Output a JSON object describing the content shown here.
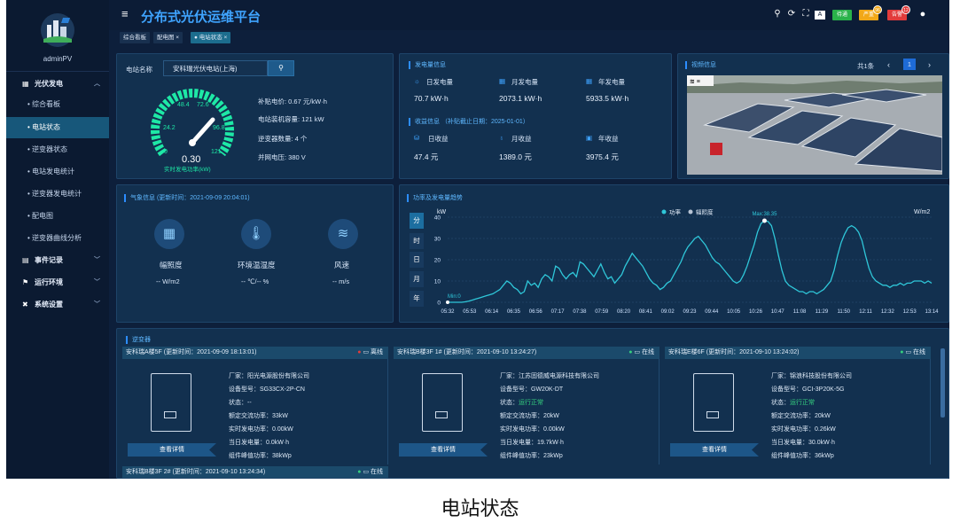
{
  "app": {
    "title": "分布式光伏运维平台",
    "user": "adminPV"
  },
  "caption": "电站状态",
  "colors": {
    "accent": "#2c8dff",
    "online": "#35d07f",
    "offline": "#e23b3b",
    "gauge": "#1ee8a6"
  },
  "header": {
    "icons": [
      "search-icon",
      "refresh-icon",
      "fullscreen-icon",
      "font-size-icon",
      "user-icon"
    ],
    "badges": [
      {
        "label": "待通",
        "color": "#2ab24a",
        "count": ""
      },
      {
        "label": "严重",
        "color": "#f2a818",
        "count": "96"
      },
      {
        "label": "告警",
        "color": "#e23b3b",
        "count": "12"
      }
    ]
  },
  "tabs": [
    {
      "label": "综合看板"
    },
    {
      "label": "配电图 ×"
    },
    {
      "label": "● 电站状态 ×"
    }
  ],
  "sidebar": {
    "groups": [
      {
        "label": "光伏发电",
        "icon": "grid-icon",
        "expanded": true
      },
      {
        "label": "事件记录",
        "icon": "calendar-icon"
      },
      {
        "label": "运行环境",
        "icon": "flag-icon"
      },
      {
        "label": "系统设置",
        "icon": "tools-icon"
      }
    ],
    "items": [
      {
        "label": "• 综合看板"
      },
      {
        "label": "• 电站状态",
        "active": true
      },
      {
        "label": "• 逆变器状态"
      },
      {
        "label": "• 电站发电统计"
      },
      {
        "label": "• 逆变器发电统计"
      },
      {
        "label": "• 配电图"
      },
      {
        "label": "• 逆变器曲线分析"
      }
    ]
  },
  "station": {
    "name_label": "电站名称",
    "name_value": "安科瑞光伏电站(上海)",
    "search_icon": "search-icon",
    "gauge": {
      "value": "0.30",
      "max": 121,
      "ticks": [
        "24.2",
        "48.4",
        "72.6",
        "96.8",
        "121"
      ],
      "zero": "0",
      "label": "实时发电功率(kW)"
    },
    "info": [
      {
        "label": "补贴电价: 0.67 元/kW·h"
      },
      {
        "label": "电站装机容量: 121 kW"
      },
      {
        "label": "逆变器数量: 4 个"
      },
      {
        "label": "并网电压: 380 V"
      }
    ]
  },
  "generation": {
    "title": "发电量信息",
    "items": [
      {
        "icon": "sun-icon",
        "label": "日发电量",
        "value": "70.7 kW·h"
      },
      {
        "icon": "calendar-icon",
        "label": "月发电量",
        "value": "2073.1 kW·h"
      },
      {
        "icon": "calendar-icon",
        "label": "年发电量",
        "value": "5933.5 kW·h"
      }
    ]
  },
  "income": {
    "title": "收益信息 （补贴截止日期：2025-01-01）",
    "items": [
      {
        "icon": "coins-icon",
        "label": "日收益",
        "value": "47.4 元"
      },
      {
        "icon": "money-bag-icon",
        "label": "月收益",
        "value": "1389.0 元"
      },
      {
        "icon": "wallet-icon",
        "label": "年收益",
        "value": "3975.4 元"
      }
    ]
  },
  "video": {
    "title": "视频信息",
    "total": "共1条",
    "page": "1",
    "prev": "‹",
    "next": "›"
  },
  "weather": {
    "title": "气象信息 (更新时间：2021-09-09 20:04:01)",
    "items": [
      {
        "icon": "solar-panel-icon",
        "label": "幅照度",
        "value": "-- W/m2"
      },
      {
        "icon": "thermometer-icon",
        "label": "环境温湿度",
        "value": "-- ℃/-- %"
      },
      {
        "icon": "wind-icon",
        "label": "风速",
        "value": "-- m/s"
      }
    ]
  },
  "chart_data": {
    "type": "line",
    "title": "功率及发电量趋势",
    "ylabel": "kW",
    "ylabel_right": "W/m2",
    "legend": [
      "功率",
      "辐照度"
    ],
    "legend_position": "top-right",
    "period_buttons": [
      "分",
      "时",
      "日",
      "月",
      "年"
    ],
    "period_active": "分",
    "ylim": [
      0,
      40
    ],
    "yticks": [
      "0",
      "10",
      "20",
      "30",
      "40"
    ],
    "xticks": [
      "05:32",
      "05:53",
      "06:14",
      "06:35",
      "06:56",
      "07:17",
      "07:38",
      "07:59",
      "08:20",
      "08:41",
      "09:02",
      "09:23",
      "09:44",
      "10:05",
      "10:26",
      "10:47",
      "11:08",
      "11:29",
      "11:50",
      "12:11",
      "12:32",
      "12:53",
      "13:14"
    ],
    "max_label": "Max:38.35",
    "min_label": "Min:0",
    "series": [
      {
        "name": "功率",
        "values": [
          0,
          0,
          0,
          0,
          0,
          0.2,
          0.5,
          1,
          1.5,
          2,
          2.5,
          3,
          3.5,
          4,
          5,
          6,
          8,
          10,
          9,
          7,
          6,
          4,
          5,
          10,
          8,
          9,
          7,
          11,
          13,
          12,
          10,
          17,
          16,
          13,
          11,
          13,
          14,
          12,
          19,
          18,
          16,
          14,
          12,
          15,
          18,
          14,
          11,
          12,
          9,
          11,
          13,
          17,
          20,
          23,
          21,
          19,
          17,
          14,
          11,
          9,
          8,
          6,
          7,
          9,
          10,
          13,
          16,
          19,
          23,
          26,
          28,
          30,
          31,
          29,
          27,
          24,
          21,
          19,
          18,
          16,
          14,
          12,
          10,
          9,
          10,
          13,
          17,
          22,
          27,
          33,
          37,
          38.35,
          38,
          36,
          30,
          22,
          15,
          10,
          8,
          7,
          6,
          5,
          5,
          4,
          5,
          5,
          4,
          5,
          6,
          8,
          10,
          15,
          22,
          28,
          32,
          35,
          36,
          35,
          33,
          29,
          22,
          16,
          12,
          10,
          9,
          8,
          8,
          7,
          8,
          8,
          9,
          8,
          9,
          9,
          10,
          10,
          10,
          9,
          10,
          9
        ]
      }
    ]
  },
  "inverters": {
    "title": "逆变器",
    "detail_label": "查看详情",
    "devices": [
      {
        "header": "安科瑞A楼5F (更新时间：2021-09-09 18:13:01)",
        "status": "离线",
        "online": false,
        "factory": "厂家：阳光电源股份有限公司",
        "model": "设备型号：SG33CX-2P-CN",
        "state_label": "状态：",
        "state_value": "--",
        "rated": "额定交流功率：33kW",
        "realtime": "实时发电功率：0.00kW",
        "daily": "当日发电量：0.0kW·h",
        "component": "组件峰值功率：38kWp"
      },
      {
        "header": "安科瑞B楼3F 1# (更新时间：2021-09-10 13:24:27)",
        "status": "在线",
        "online": true,
        "factory": "厂家：江苏固德威电源科技有限公司",
        "model": "设备型号：GW20K-DT",
        "state_label": "状态：",
        "state_value": "运行正常",
        "rated": "额定交流功率：20kW",
        "realtime": "实时发电功率：0.00kW",
        "daily": "当日发电量：19.7kW·h",
        "component": "组件峰值功率：23kWp"
      },
      {
        "header": "安科瑞E楼6F (更新时间：2021-09-10 13:24:02)",
        "status": "在线",
        "online": true,
        "factory": "厂家：锦浪科技股份有限公司",
        "model": "设备型号：GCI-3P20K-5G",
        "state_label": "状态：",
        "state_value": "运行正常",
        "rated": "额定交流功率：20kW",
        "realtime": "实时发电功率：0.26kW",
        "daily": "当日发电量：30.0kW·h",
        "component": "组件峰值功率：36kWp"
      }
    ],
    "partial_header": "安科瑞B楼3F 2# (更新时间：2021-09-10 13:24:34)",
    "partial_status": "在线"
  }
}
